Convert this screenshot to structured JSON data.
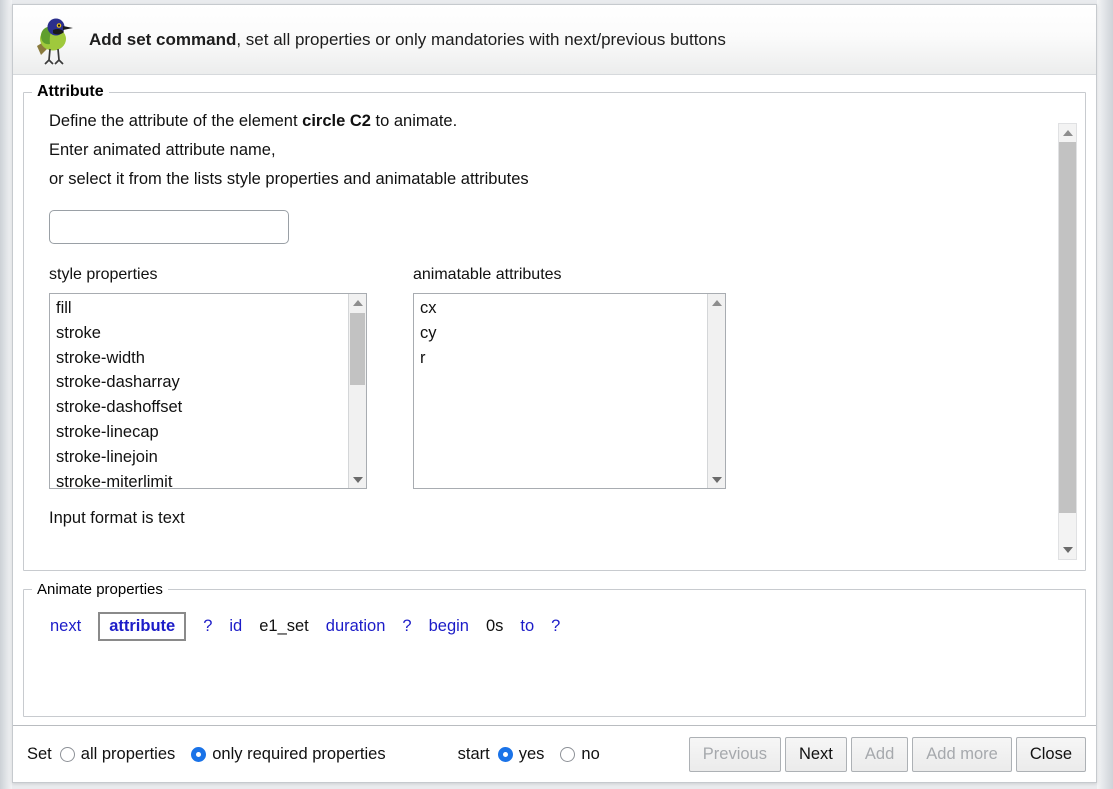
{
  "header": {
    "icon": "bird-icon",
    "title_bold": "Add set command",
    "title_rest": ", set all properties or only mandatories with next/previous buttons"
  },
  "attribute_panel": {
    "legend": "Attribute",
    "line1_prefix": "Define the attribute of the element ",
    "line1_bold": "circle C2",
    "line1_suffix": " to animate.",
    "line2": "Enter animated attribute name,",
    "line3": "or select it from the lists style properties and animatable attributes",
    "input_value": "",
    "input_placeholder": "",
    "style_list": {
      "label": "style properties",
      "options": [
        "fill",
        "stroke",
        "stroke-width",
        "stroke-dasharray",
        "stroke-dashoffset",
        "stroke-linecap",
        "stroke-linejoin",
        "stroke-miterlimit"
      ]
    },
    "attrs_list": {
      "label": "animatable attributes",
      "options": [
        "cx",
        "cy",
        "r"
      ]
    },
    "input_format": "Input format is text"
  },
  "animate_panel": {
    "legend": "Animate properties",
    "tokens": [
      {
        "text": "next",
        "style": "blue"
      },
      {
        "text": "attribute",
        "style": "boxed"
      },
      {
        "text": "?",
        "style": "blue"
      },
      {
        "text": "id",
        "style": "blue"
      },
      {
        "text": "e1_set",
        "style": "black"
      },
      {
        "text": "duration",
        "style": "blue"
      },
      {
        "text": "?",
        "style": "blue"
      },
      {
        "text": "begin",
        "style": "blue"
      },
      {
        "text": "0s",
        "style": "black"
      },
      {
        "text": "to",
        "style": "blue"
      },
      {
        "text": "?",
        "style": "blue"
      }
    ]
  },
  "footer": {
    "set_label": "Set",
    "set_option_all": "all properties",
    "set_option_required": "only required properties",
    "set_selected": "only required properties",
    "start_label": "start",
    "start_option_yes": "yes",
    "start_option_no": "no",
    "start_selected": "yes",
    "buttons": [
      {
        "label": "Previous",
        "disabled": true
      },
      {
        "label": "Next",
        "disabled": false
      },
      {
        "label": "Add",
        "disabled": true
      },
      {
        "label": "Add more",
        "disabled": true
      },
      {
        "label": "Close",
        "disabled": false
      }
    ]
  },
  "colors": {
    "accent_blue": "#1a73e8",
    "token_blue": "#1c1cc8",
    "panel_border": "#c8cbcf",
    "scrollbar_thumb": "#c2c2c2"
  }
}
